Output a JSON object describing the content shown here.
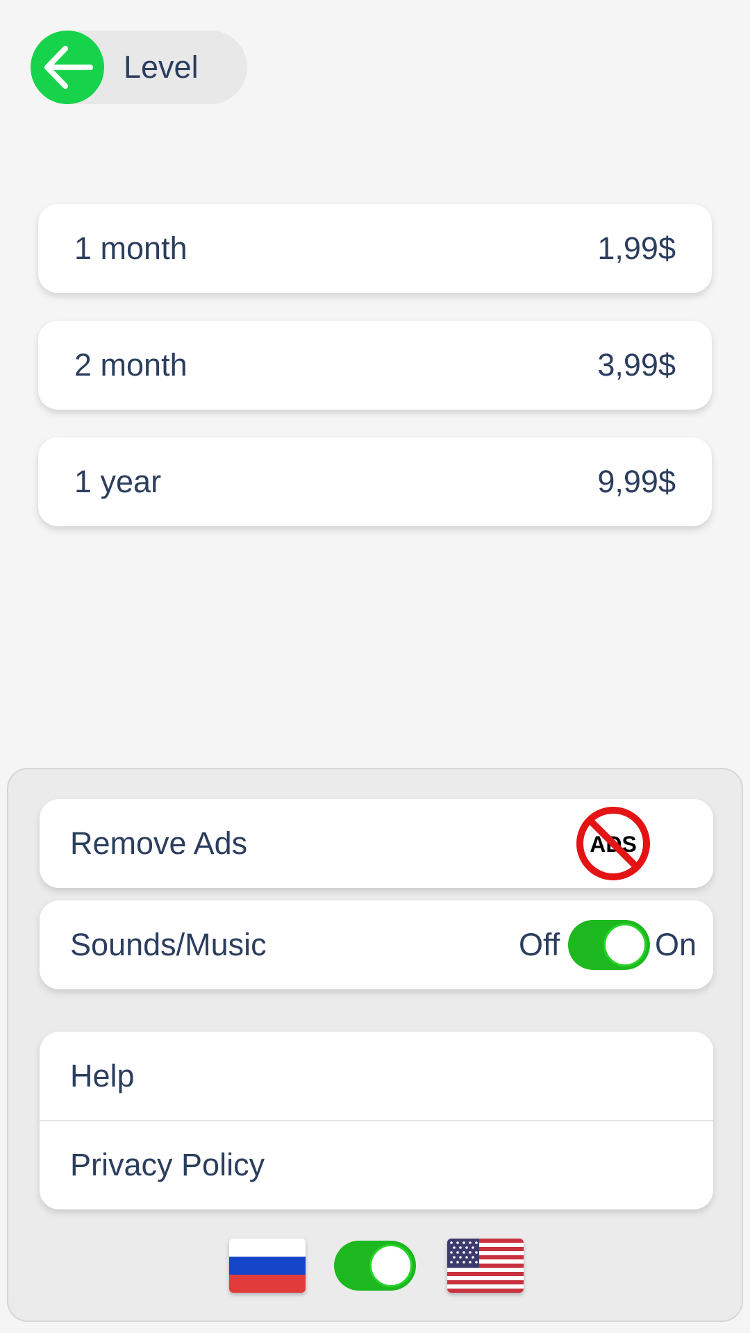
{
  "header": {
    "back_label": "Level",
    "back_icon": "arrow-left-icon"
  },
  "plans": [
    {
      "name": "1 month",
      "price": "1,99$"
    },
    {
      "name": "2 month",
      "price": "3,99$"
    },
    {
      "name": "1 year",
      "price": "9,99$"
    }
  ],
  "settings": {
    "remove_ads": {
      "label": "Remove Ads",
      "icon_text": "ADS"
    },
    "sounds": {
      "label": "Sounds/Music",
      "off_label": "Off",
      "on_label": "On",
      "state": "on"
    },
    "links": {
      "help": "Help",
      "privacy": "Privacy Policy"
    },
    "language": {
      "left_flag": "russia-flag-icon",
      "right_flag": "usa-flag-icon",
      "switch_state": "on"
    }
  },
  "colors": {
    "accent_green": "#17d34c",
    "switch_green": "#1db81f",
    "text": "#2c3e5e",
    "ads_red": "#e41414"
  }
}
